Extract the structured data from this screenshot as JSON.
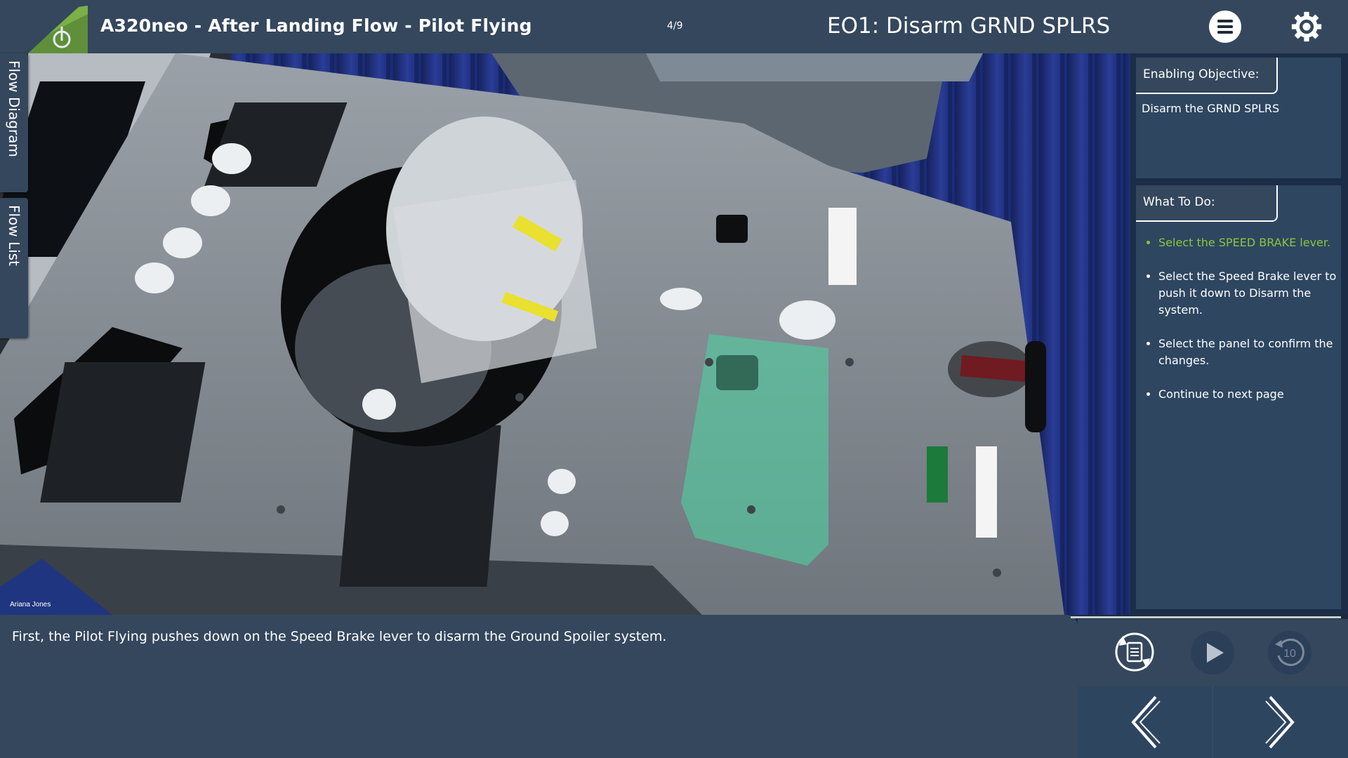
{
  "header": {
    "app_title": "A320neo - After Landing Flow - Pilot Flying",
    "page_count": "4/9",
    "eo_title": "EO1: Disarm GRND SPLRS",
    "menu_icon": "hamburger-menu-icon",
    "settings_icon": "gear-icon"
  },
  "side_tabs": {
    "flow_diagram": "Flow Diagram",
    "flow_list": "Flow List"
  },
  "objective": {
    "header": "Enabling Objective:",
    "text": "Disarm the GRND SPLRS"
  },
  "todo": {
    "header": "What To Do:",
    "items": [
      {
        "text": "Select the SPEED BRAKE lever.",
        "active": true
      },
      {
        "text": "Select the Speed Brake lever to push it down to Disarm the system.",
        "active": false
      },
      {
        "text": "Select the panel to confirm the changes.",
        "active": false
      },
      {
        "text": "Continue to next page",
        "active": false
      }
    ]
  },
  "scene": {
    "credit": "Ariana Jones"
  },
  "narration": {
    "text": "First, the Pilot Flying pushes down on the Speed Brake lever to disarm the Ground Spoiler system."
  },
  "controls": {
    "replay_label": "10",
    "transcript_icon": "transcript-refresh-icon",
    "play_icon": "play-icon",
    "replay_icon": "replay-10-icon",
    "prev_icon": "chevron-left-icon",
    "next_icon": "chevron-right-icon"
  },
  "colors": {
    "header_bg": "#34475d",
    "panel_bg": "#2e4660",
    "accent_green": "#8bc53f",
    "highlight_green": "#4fd0a0"
  }
}
